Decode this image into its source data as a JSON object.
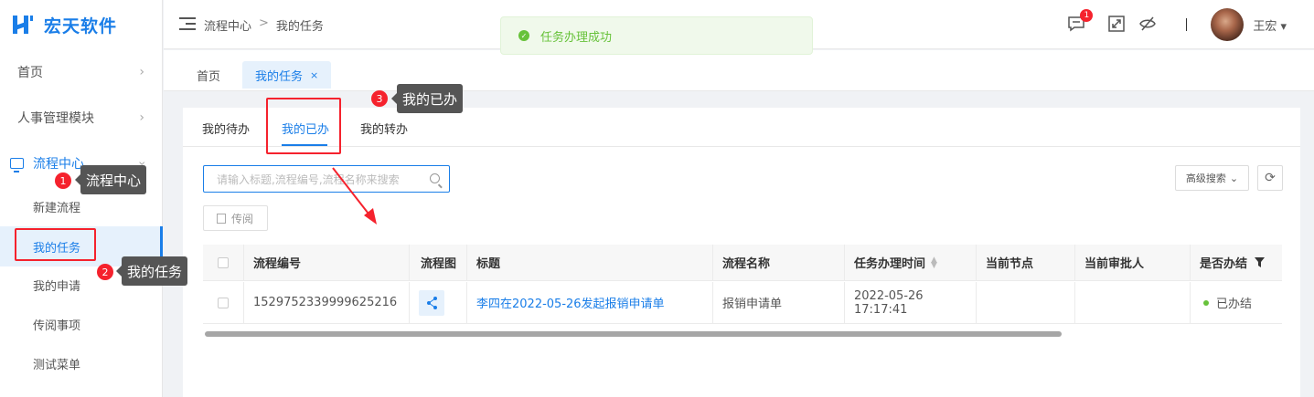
{
  "brand": {
    "name": "宏天软件",
    "accent": "#1a7ee8"
  },
  "sidebar": {
    "menus": [
      {
        "label": "首页"
      },
      {
        "label": "人事管理模块"
      },
      {
        "label": "流程中心"
      }
    ],
    "subitems": [
      {
        "label": "新建流程"
      },
      {
        "label": "我的任务"
      },
      {
        "label": "我的申请"
      },
      {
        "label": "传阅事项"
      },
      {
        "label": "测试菜单"
      }
    ]
  },
  "header": {
    "breadcrumb": [
      "流程中心",
      "我的任务"
    ],
    "breadcrumb_sep": ">",
    "notification_count": "1",
    "username": "王宏"
  },
  "page_tabs": [
    {
      "label": "首页"
    },
    {
      "label": "我的任务",
      "close": "×"
    }
  ],
  "toast": {
    "message": "任务办理成功"
  },
  "sub_tabs": [
    {
      "label": "我的待办"
    },
    {
      "label": "我的已办"
    },
    {
      "label": "我的转办"
    }
  ],
  "search": {
    "placeholder": "请输入标题,流程编号,流程名称来搜索"
  },
  "toolbar": {
    "circulate": "传阅",
    "advanced_search": "高级搜索",
    "refresh": "⟳"
  },
  "table": {
    "columns": [
      "流程编号",
      "流程图",
      "标题",
      "流程名称",
      "任务办理时间",
      "当前节点",
      "当前审批人",
      "是否办结"
    ],
    "rows": [
      {
        "id": "1529752339999625216",
        "title": "李四在2022-05-26发起报销申请单",
        "process": "报销申请单",
        "time": "2022-05-26 17:17:41",
        "node": "",
        "approver": "",
        "status": "已办结"
      }
    ]
  },
  "annotations": [
    {
      "num": "1",
      "label": "流程中心"
    },
    {
      "num": "2",
      "label": "我的任务"
    },
    {
      "num": "3",
      "label": "我的已办"
    }
  ]
}
